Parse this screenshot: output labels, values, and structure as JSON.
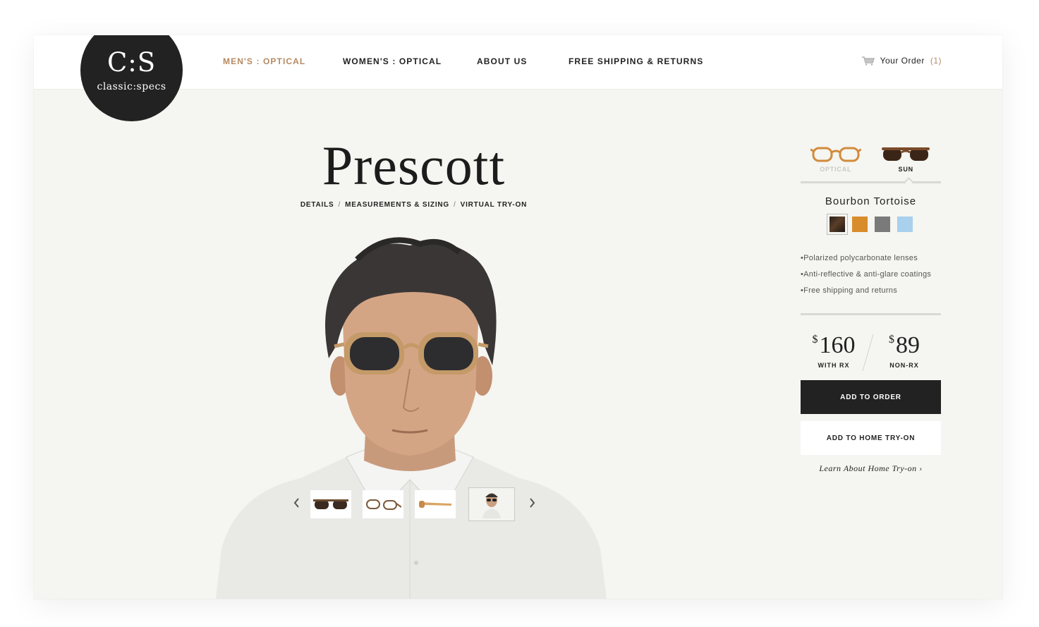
{
  "brand": {
    "mark": "C:S",
    "wordmark": "classic:specs"
  },
  "nav": {
    "items": [
      {
        "label": "MEN'S : OPTICAL",
        "active": true
      },
      {
        "label": "WOMEN'S : OPTICAL",
        "active": false
      },
      {
        "label": "ABOUT US",
        "active": false
      },
      {
        "label": "FREE SHIPPING & RETURNS",
        "active": false
      }
    ],
    "order_label": "Your Order",
    "order_count": "(1)"
  },
  "product": {
    "name": "Prescott",
    "subnav": [
      "DETAILS",
      "MEASUREMENTS & SIZING",
      "VIRTUAL TRY-ON"
    ],
    "variants": [
      {
        "label": "OPTICAL",
        "selected": false
      },
      {
        "label": "SUN",
        "selected": true
      }
    ],
    "color_name": "Bourbon Tortoise",
    "swatches": [
      {
        "name": "bourbon-tortoise",
        "color": "#3b2a1e",
        "selected": true
      },
      {
        "name": "amber",
        "color": "#d98c2b",
        "selected": false
      },
      {
        "name": "grey",
        "color": "#7a7a7a",
        "selected": false
      },
      {
        "name": "sky-blue",
        "color": "#a9d0ec",
        "selected": false
      }
    ],
    "features": [
      "Polarized polycarbonate lenses",
      "Anti-reflective & anti-glare coatings",
      "Free shipping and returns"
    ],
    "prices": {
      "currency": "$",
      "with_rx": {
        "amount": "160",
        "label": "WITH RX"
      },
      "non_rx": {
        "amount": "89",
        "label": "NON-RX"
      }
    },
    "buttons": {
      "add_to_order": "ADD TO ORDER",
      "add_to_home_tryon": "ADD TO HOME TRY-ON",
      "learn_more": "Learn About Home Try-on ›"
    }
  },
  "colors": {
    "accent": "#b58a63",
    "dark": "#222222",
    "background": "#f5f5f1"
  }
}
